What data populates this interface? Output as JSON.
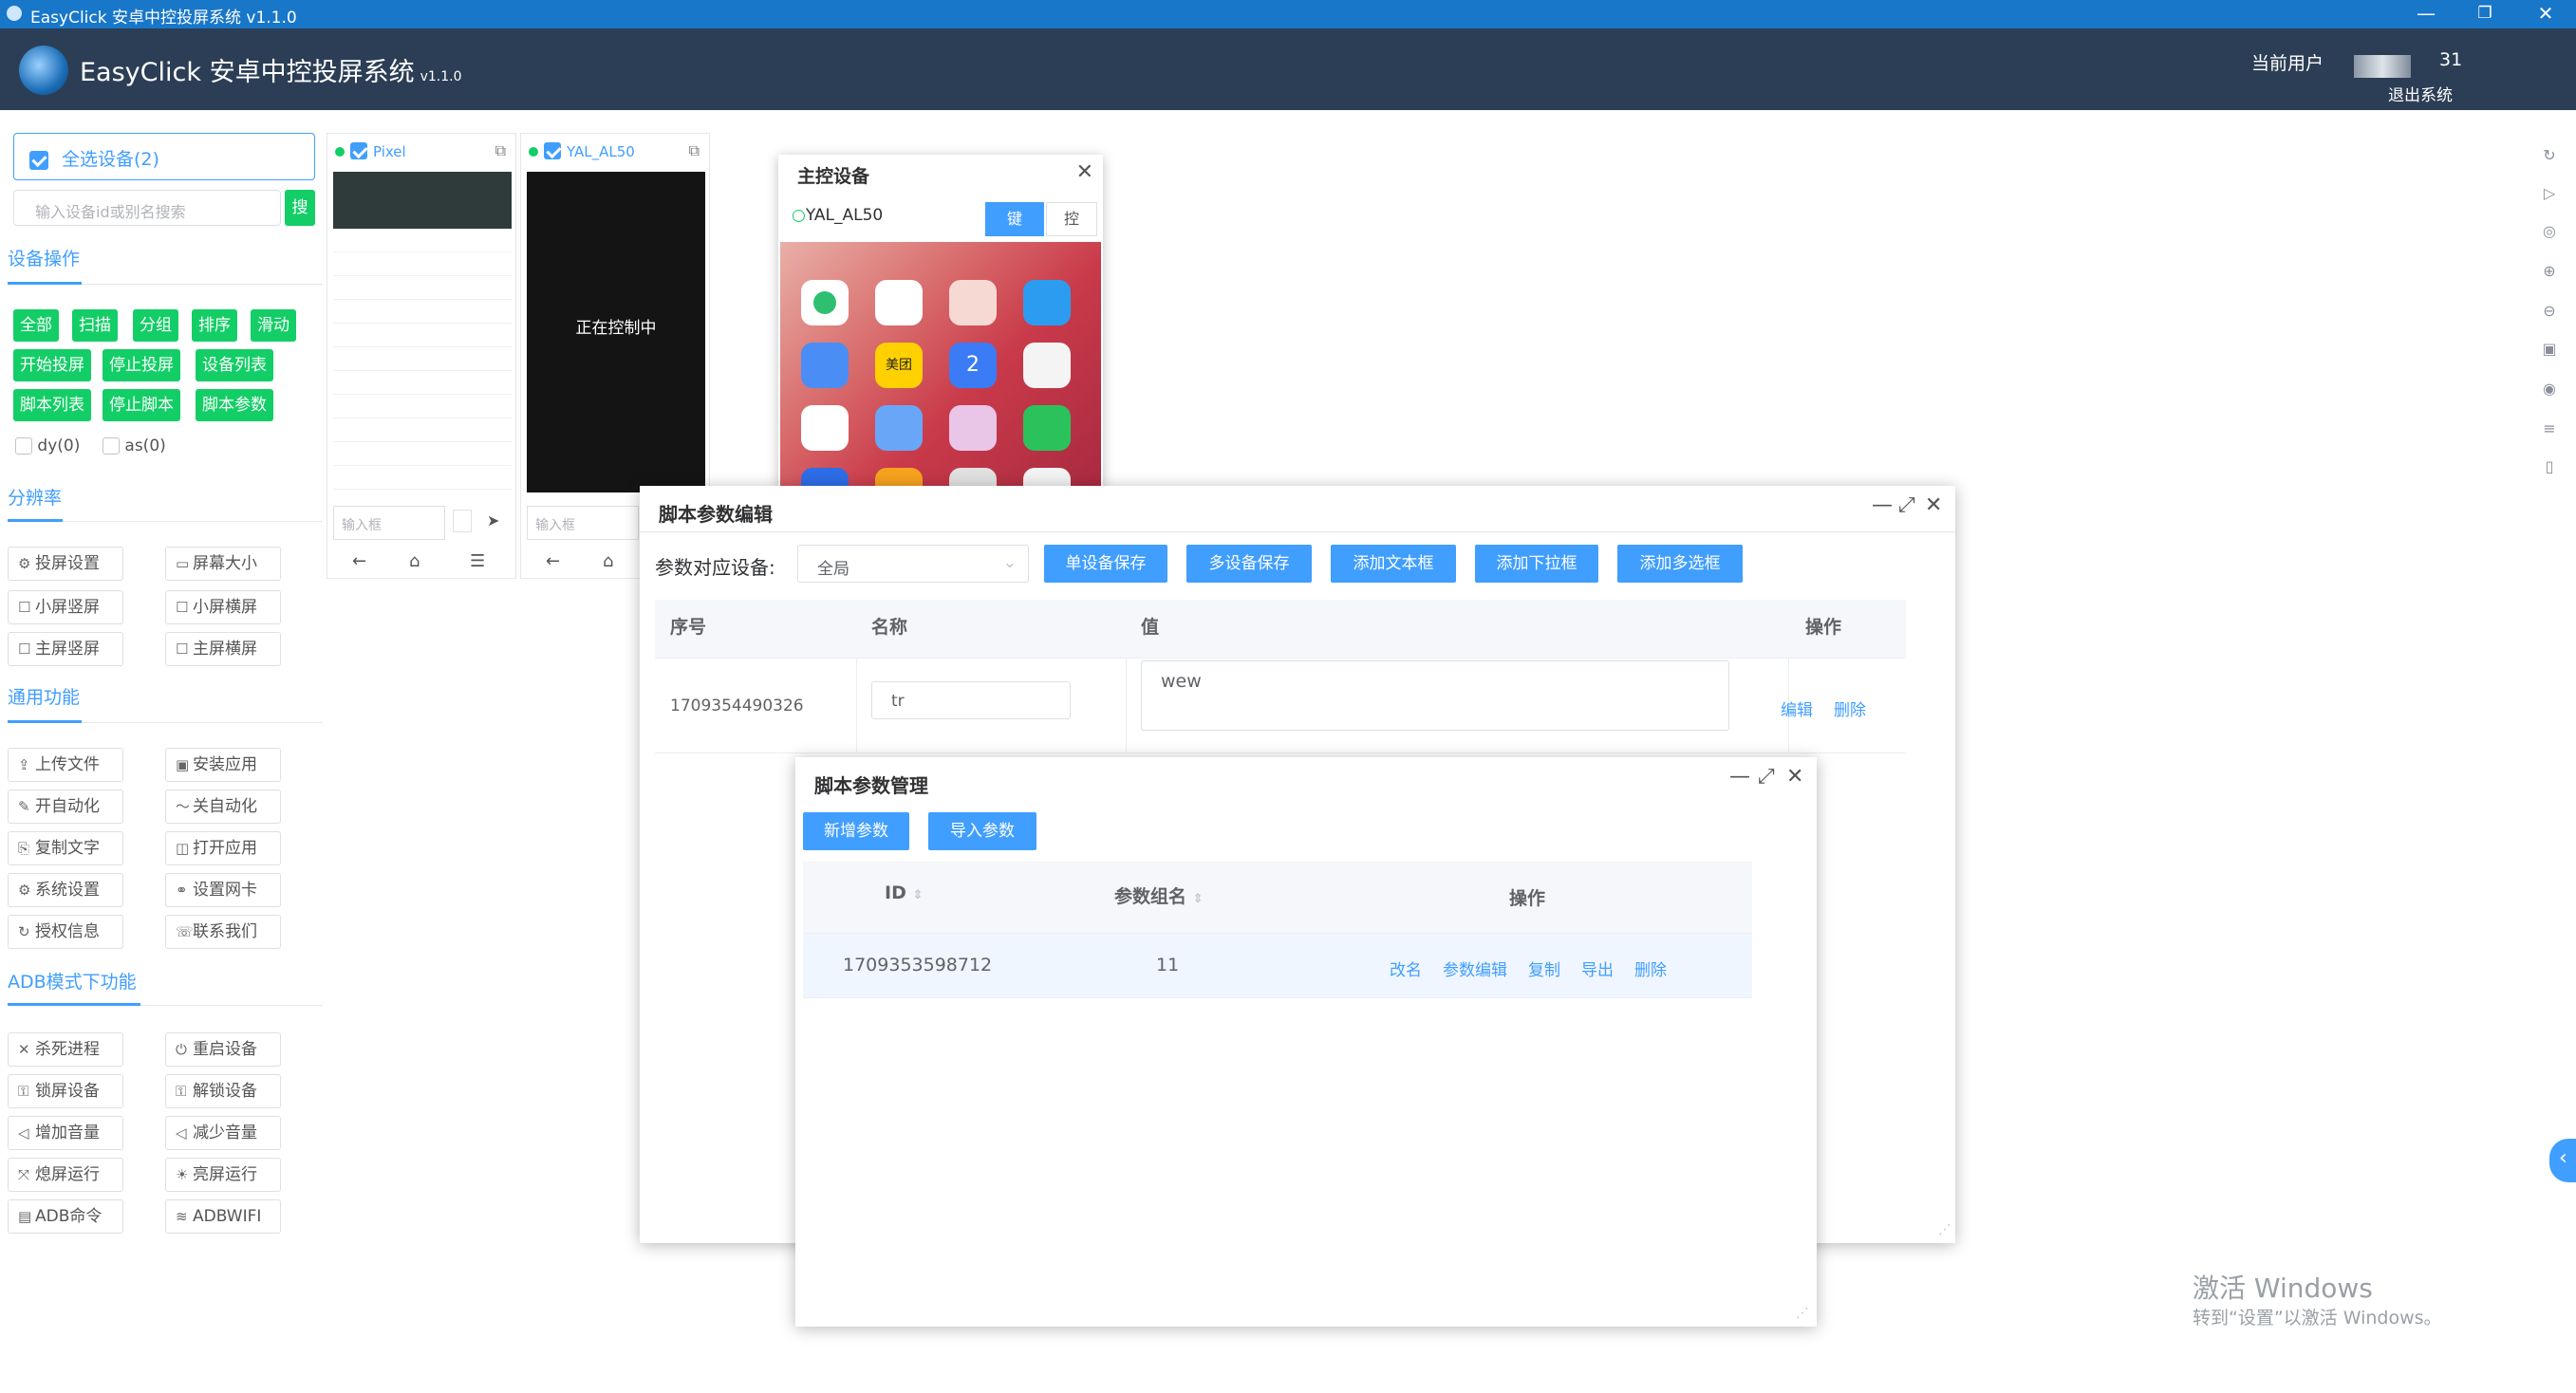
{
  "window": {
    "title": "EasyClick 安卓中控投屏系统 v1.1.0",
    "min": "—",
    "restore": "❐",
    "close": "✕"
  },
  "header": {
    "app_name": "EasyClick 安卓中控投屏系统",
    "version": "v1.1.0",
    "current_user_label": "当前用户",
    "user_id": "31",
    "logout": "退出系统"
  },
  "sidebar": {
    "select_all": "全选设备(2)",
    "search_placeholder": "输入设备id或别名搜索",
    "search_button": "搜",
    "section_device_ops": "设备操作",
    "device_ops": [
      "全部",
      "扫描",
      "分组",
      "排序",
      "滑动",
      "开始投屏",
      "停止投屏",
      "设备列表",
      "脚本列表",
      "停止脚本",
      "脚本参数"
    ],
    "group_checks": [
      "dy(0)",
      "as(0)"
    ],
    "section_resolution": "分辨率",
    "resolution_btns": [
      "投屏设置",
      "屏幕大小",
      "小屏竖屏",
      "小屏横屏",
      "主屏竖屏",
      "主屏横屏"
    ],
    "section_common": "通用功能",
    "common_btns": [
      "上传文件",
      "安装应用",
      "开自动化",
      "关自动化",
      "复制文字",
      "打开应用",
      "系统设置",
      "设置网卡",
      "授权信息",
      "联系我们"
    ],
    "section_adb": "ADB模式下功能",
    "adb_btns": [
      "杀死进程",
      "重启设备",
      "锁屏设备",
      "解锁设备",
      "增加音量",
      "减少音量",
      "熄屏运行",
      "亮屏运行",
      "ADB命令",
      "ADBWIFI"
    ]
  },
  "devices": [
    {
      "name": "Pixel",
      "input_placeholder": "输入框",
      "status": ""
    },
    {
      "name": "YAL_AL50",
      "input_placeholder": "输入框",
      "status": "正在控制中"
    }
  ],
  "main_device": {
    "title": "主控设备",
    "device": "YAL_AL50",
    "btn_key": "键",
    "btn_control": "控",
    "app_labels": [
      "美团",
      "2"
    ]
  },
  "param_editor": {
    "title": "脚本参数编辑",
    "device_label": "参数对应设备:",
    "device_select": "全局",
    "buttons": [
      "单设备保存",
      "多设备保存",
      "添加文本框",
      "添加下拉框",
      "添加多选框"
    ],
    "columns": [
      "序号",
      "名称",
      "值",
      "操作"
    ],
    "row": {
      "id": "1709354490326",
      "name": "tr",
      "value": "wew",
      "edit": "编辑",
      "delete": "删除"
    }
  },
  "param_manager": {
    "title": "脚本参数管理",
    "buttons": [
      "新增参数",
      "导入参数"
    ],
    "columns": [
      "ID",
      "参数组名",
      "操作"
    ],
    "row": {
      "id": "1709353598712",
      "group": "11",
      "actions": [
        "改名",
        "参数编辑",
        "复制",
        "导出",
        "删除"
      ]
    }
  },
  "watermark": {
    "line1": "激活 Windows",
    "line2": "转到“设置”以激活 Windows。"
  },
  "colors": {
    "titlebar": "#1877c9",
    "header": "#2c3e55",
    "primary": "#409eff",
    "success": "#13ce66"
  }
}
